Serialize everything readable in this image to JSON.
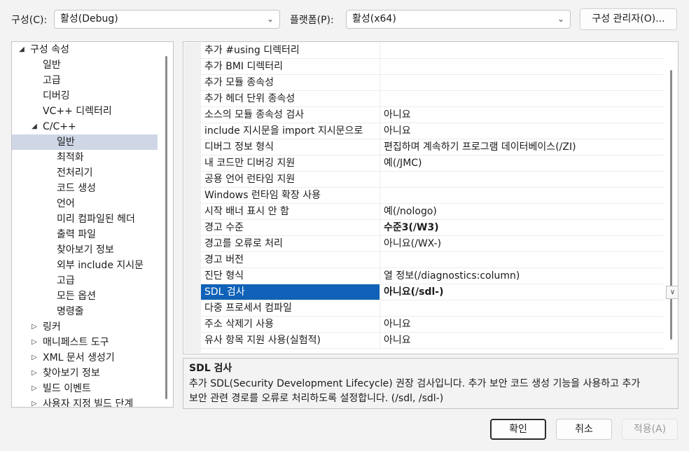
{
  "config": {
    "label": "구성(C):",
    "value": "활성(Debug)"
  },
  "platform": {
    "label": "플랫폼(P):",
    "value": "활성(x64)"
  },
  "config_manager_button": "구성 관리자(O)...",
  "tree": [
    {
      "label": "구성 속성",
      "arrow": "◢",
      "level": 0
    },
    {
      "label": "일반",
      "arrow": "",
      "level": 1
    },
    {
      "label": "고급",
      "arrow": "",
      "level": 1
    },
    {
      "label": "디버깅",
      "arrow": "",
      "level": 1
    },
    {
      "label": "VC++ 디렉터리",
      "arrow": "",
      "level": 1
    },
    {
      "label": "C/C++",
      "arrow": "◢",
      "level": 1
    },
    {
      "label": "일반",
      "arrow": "",
      "level": 2,
      "selected": true
    },
    {
      "label": "최적화",
      "arrow": "",
      "level": 2
    },
    {
      "label": "전처리기",
      "arrow": "",
      "level": 2
    },
    {
      "label": "코드 생성",
      "arrow": "",
      "level": 2
    },
    {
      "label": "언어",
      "arrow": "",
      "level": 2
    },
    {
      "label": "미리 컴파일된 헤더",
      "arrow": "",
      "level": 2
    },
    {
      "label": "출력 파일",
      "arrow": "",
      "level": 2
    },
    {
      "label": "찾아보기 정보",
      "arrow": "",
      "level": 2
    },
    {
      "label": "외부 include 지시문",
      "arrow": "",
      "level": 2
    },
    {
      "label": "고급",
      "arrow": "",
      "level": 2
    },
    {
      "label": "모든 옵션",
      "arrow": "",
      "level": 2
    },
    {
      "label": "명령줄",
      "arrow": "",
      "level": 2
    },
    {
      "label": "링커",
      "arrow": "▷",
      "level": 1
    },
    {
      "label": "매니페스트 도구",
      "arrow": "▷",
      "level": 1
    },
    {
      "label": "XML 문서 생성기",
      "arrow": "▷",
      "level": 1
    },
    {
      "label": "찾아보기 정보",
      "arrow": "▷",
      "level": 1
    },
    {
      "label": "빌드 이벤트",
      "arrow": "▷",
      "level": 1
    },
    {
      "label": "사용자 지정 빌드 단계",
      "arrow": "▷",
      "level": 1
    }
  ],
  "properties": [
    {
      "name": "추가 #using 디렉터리",
      "value": ""
    },
    {
      "name": "추가 BMI 디렉터리",
      "value": ""
    },
    {
      "name": "추가 모듈 종속성",
      "value": ""
    },
    {
      "name": "추가 헤더 단위 종속성",
      "value": ""
    },
    {
      "name": "소스의 모듈 종속성 검사",
      "value": "아니요"
    },
    {
      "name": "include 지시문을 import 지시문으로",
      "value": "아니요"
    },
    {
      "name": "디버그 정보 형식",
      "value": "편집하며 계속하기 프로그램 데이터베이스(/ZI)"
    },
    {
      "name": "내 코드만 디버깅 지원",
      "value": "예(/JMC)"
    },
    {
      "name": "공용 언어 런타임 지원",
      "value": ""
    },
    {
      "name": "Windows 런타임 확장 사용",
      "value": ""
    },
    {
      "name": "시작 배너 표시 안 함",
      "value": "예(/nologo)"
    },
    {
      "name": "경고 수준",
      "value": "수준3(/W3)",
      "bold": true
    },
    {
      "name": "경고를 오류로 처리",
      "value": "아니요(/WX-)"
    },
    {
      "name": "경고 버전",
      "value": ""
    },
    {
      "name": "진단 형식",
      "value": "열 정보(/diagnostics:column)"
    },
    {
      "name": "SDL 검사",
      "value": "아니요(/sdl-)",
      "bold": true,
      "selected": true
    },
    {
      "name": "다중 프로세서 컴파일",
      "value": ""
    },
    {
      "name": "주소 삭제기 사용",
      "value": "아니요"
    },
    {
      "name": "유사 항목 지원 사용(실험적)",
      "value": "아니요"
    }
  ],
  "description": {
    "title": "SDL 검사",
    "line1": "추가 SDL(Security Development Lifecycle) 권장 검사입니다. 추가 보안 코드 생성 기능을 사용하고 추가",
    "line2": "보안 관련 경로를 오류로 처리하도록 설정합니다. (/sdl, /sdl-)"
  },
  "buttons": {
    "ok": "확인",
    "cancel": "취소",
    "apply": "적용(A)"
  },
  "icons": {
    "dropdown": "chevron-down-icon",
    "expanded": "expanded-triangle-icon",
    "collapsed": "collapsed-triangle-icon"
  },
  "colors": {
    "selection": "#0f62b8",
    "tree_selection": "#cfd6e6"
  }
}
